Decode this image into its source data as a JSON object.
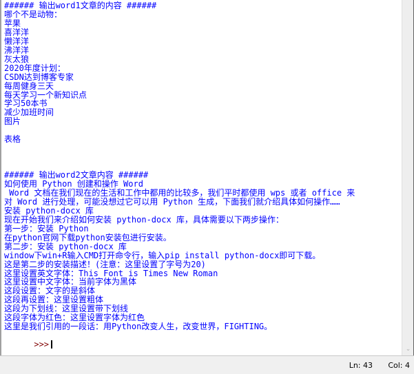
{
  "output_lines": [
    "###### 输出word1文章的内容 ######",
    "哪个不是动物：",
    "苹果",
    "喜洋洋",
    "懒洋洋",
    "沸洋洋",
    "灰太狼",
    "2020年度计划：",
    "CSDN达到博客专家",
    "每周健身三天",
    "每天学习一个新知识点",
    "学习50本书",
    "减少加班时间",
    "图片",
    "",
    "表格",
    "",
    "",
    "",
    "###### 输出word2文章内容 ######",
    "如何使用 Python 创建和操作 Word",
    " Word 文档在我们现在的生活和工作中都用的比较多，我们平时都使用 wps 或者 office 来",
    "对 Word 进行处理，可能没想过它可以用 Python 生成，下面我们就介绍具体如何操作……",
    "安装 python-docx 库",
    "现在开始我们来介绍如何安装 python-docx 库，具体需要以下两步操作：",
    "第一步：安装 Python",
    "在python官网下载python安装包进行安装。",
    "第二步：安装 python-docx 库",
    "window下win+R输入CMD打开命令行，输入pip install python-docx即可下载。",
    "这是第二步的安装描述！(注意：这里设置了字号为20)",
    "这里设置英文字体：This Font is Times New Roman",
    "这里设置中文字体：当前字体为黑体",
    "这段设置：文字的是斜体",
    "这段再设置：这里设置粗体",
    "这段为下划线：这里设置带下划线",
    "这段字体为红色：这里设置字体为红色",
    "这里是我们引用的一段话：用Python改变人生，改变世界，FIGHTING。"
  ],
  "prompt": ">>>",
  "colors": {
    "output_text": "#0000ff",
    "prompt": "#800000"
  },
  "scrollbar": {
    "down_arrow_icon": "⌄"
  },
  "status": {
    "line": "Ln: 43",
    "col": "Col: 4"
  }
}
